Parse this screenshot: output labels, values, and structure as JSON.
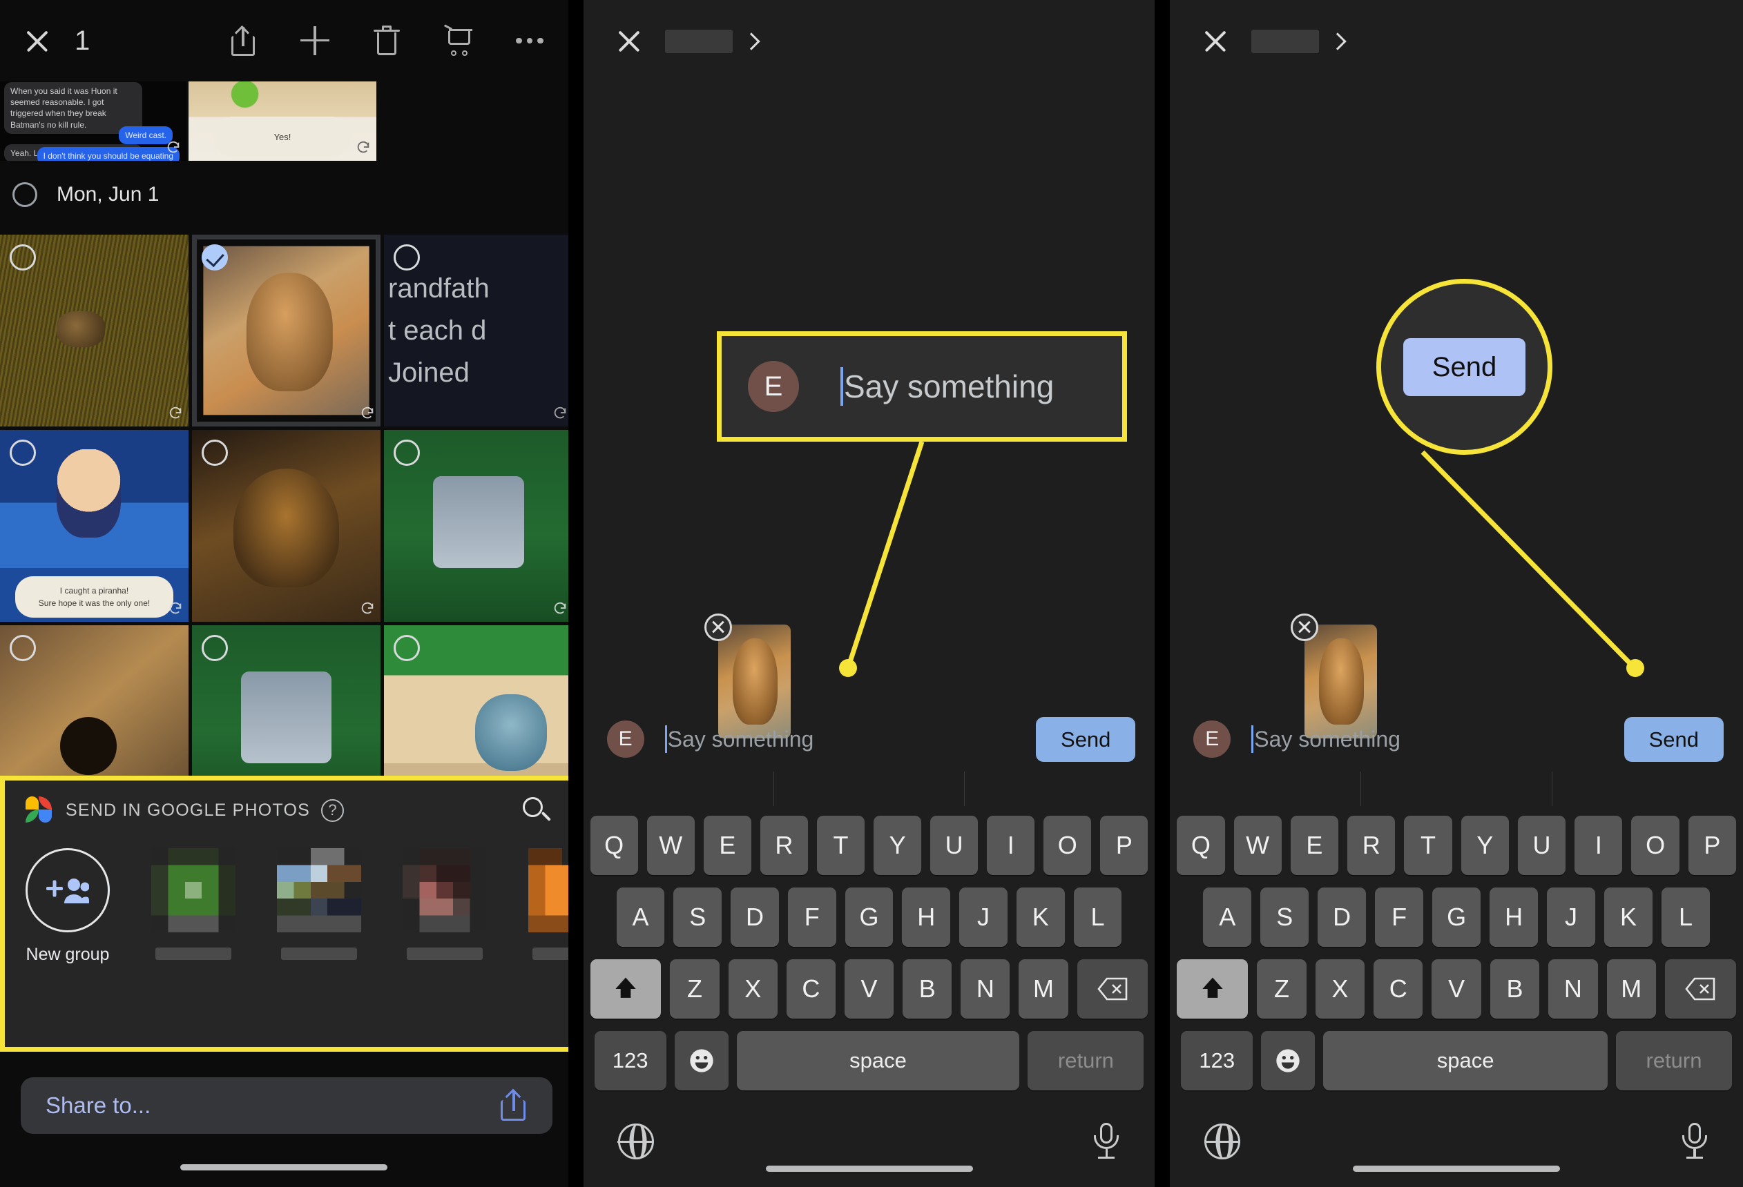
{
  "left_panel": {
    "toolbar": {
      "close_icon": "close-icon",
      "selection_count": "1",
      "actions": [
        "share-icon",
        "plus-icon",
        "trash-icon",
        "cart-icon",
        "more-icon"
      ]
    },
    "chat_tiles": [
      {
        "bubbles": [
          {
            "text": "When you said it was Huon it seemed reasonable. I got triggered when they break Batman's no kill rule.",
            "style": "gray"
          },
          {
            "text": "Weird cast.",
            "style": "blue"
          },
          {
            "text": "Yeah. Let me know about that one",
            "style": "gray"
          },
          {
            "text": "I don't think you should be equating",
            "style": "blue"
          }
        ]
      },
      {
        "caption": "Yes!"
      }
    ],
    "date_header": {
      "label": "Mon, Jun 1",
      "checkbox": "unchecked"
    },
    "grid": [
      [
        {
          "alt": "dog in grass",
          "selected": false
        },
        {
          "alt": "yorkie on couch",
          "selected": true
        },
        {
          "alt": "text screenshot",
          "lines": [
            "randfath",
            "t each d",
            "Joined"
          ],
          "selected": false
        }
      ],
      [
        {
          "alt": "animal crossing fishing",
          "caption_line1": "I caught a piranha!",
          "caption_line2": "Sure hope it was the only one!",
          "selected": false
        },
        {
          "alt": "dog sleeping",
          "selected": false
        },
        {
          "alt": "animal crossing villager",
          "selected": false
        }
      ],
      [
        {
          "alt": "dog fur closeup",
          "selected": false
        },
        {
          "alt": "animal crossing bench",
          "selected": false
        },
        {
          "alt": "animal crossing beach",
          "selected": false
        }
      ]
    ],
    "share_sheet": {
      "logo": "google-photos-icon",
      "title": "SEND IN GOOGLE PHOTOS",
      "help_icon": "question-mark-icon",
      "search_icon": "search-icon",
      "contacts": [
        {
          "label": "New group",
          "icon": "add-group-icon"
        },
        {
          "label": "",
          "avatar": "blurred-avatar-1"
        },
        {
          "label": "",
          "avatar": "blurred-avatar-2"
        },
        {
          "label": "",
          "avatar": "blurred-avatar-3"
        },
        {
          "label": "",
          "avatar": "blurred-avatar-4"
        }
      ]
    },
    "share_bar": {
      "label": "Share to...",
      "icon": "share-icon"
    }
  },
  "mid_panel": {
    "header": {
      "close_icon": "close-icon",
      "recipient": "",
      "chevron_icon": "chevron-right-icon"
    },
    "attachment": {
      "alt": "yorkie photo attachment",
      "remove_icon": "remove-attachment-icon"
    },
    "compose": {
      "avatar_initial": "E",
      "placeholder": "Say something",
      "send_label": "Send"
    },
    "keyboard": {
      "row1": [
        "Q",
        "W",
        "E",
        "R",
        "T",
        "Y",
        "U",
        "I",
        "O",
        "P"
      ],
      "row2": [
        "A",
        "S",
        "D",
        "F",
        "G",
        "H",
        "J",
        "K",
        "L"
      ],
      "row3": [
        "Z",
        "X",
        "C",
        "V",
        "B",
        "N",
        "M"
      ],
      "shift_icon": "shift-icon",
      "backspace_icon": "backspace-icon",
      "numbers_label": "123",
      "emoji_icon": "emoji-icon",
      "space_label": "space",
      "return_label": "return",
      "globe_icon": "globe-icon",
      "mic_icon": "microphone-icon"
    }
  },
  "right_panel": {
    "header": {
      "close_icon": "close-icon",
      "recipient": "",
      "chevron_icon": "chevron-right-icon"
    },
    "attachment": {
      "alt": "yorkie photo attachment",
      "remove_icon": "remove-attachment-icon"
    },
    "compose": {
      "avatar_initial": "E",
      "placeholder": "Say something",
      "send_label": "Send"
    },
    "keyboard": {
      "row1": [
        "Q",
        "W",
        "E",
        "R",
        "T",
        "Y",
        "U",
        "I",
        "O",
        "P"
      ],
      "row2": [
        "A",
        "S",
        "D",
        "F",
        "G",
        "H",
        "J",
        "K",
        "L"
      ],
      "row3": [
        "Z",
        "X",
        "C",
        "V",
        "B",
        "N",
        "M"
      ],
      "shift_icon": "shift-icon",
      "backspace_icon": "backspace-icon",
      "numbers_label": "123",
      "emoji_icon": "emoji-icon",
      "space_label": "space",
      "return_label": "return",
      "globe_icon": "globe-icon",
      "mic_icon": "microphone-icon"
    }
  },
  "callouts": {
    "say_something": {
      "avatar_initial": "E",
      "text": "Say something"
    },
    "send": {
      "label": "Send"
    },
    "highlight_color": "#f7e438"
  }
}
